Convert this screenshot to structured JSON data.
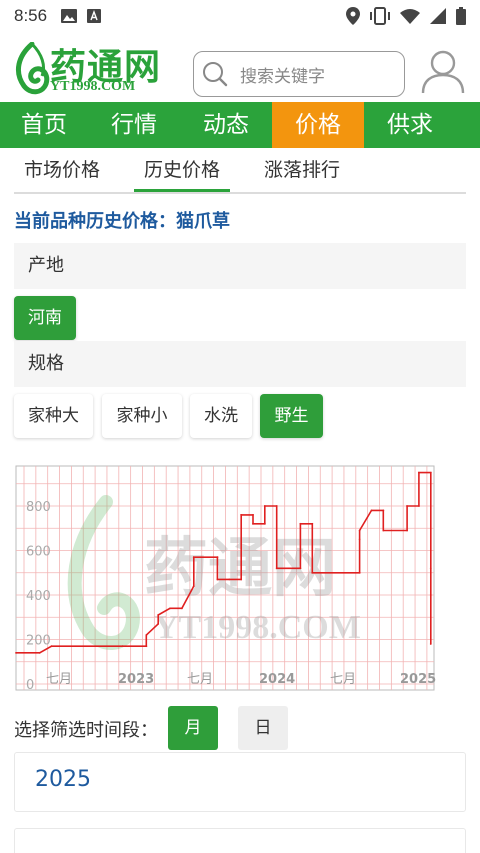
{
  "status_bar": {
    "time": "8:56"
  },
  "header": {
    "logo_text": "药通网",
    "logo_sub": "YT1998.COM",
    "search_placeholder": "搜索关键字"
  },
  "nav": {
    "items": [
      "首页",
      "行情",
      "动态",
      "价格",
      "供求"
    ],
    "active": "价格"
  },
  "subtabs": {
    "items": [
      "市场价格",
      "历史价格",
      "涨落排行"
    ],
    "active": "历史价格"
  },
  "title": "当前品种历史价格：猫爪草",
  "origin": {
    "label": "产地",
    "options": [
      "河南"
    ],
    "selected": "河南"
  },
  "spec": {
    "label": "规格",
    "options": [
      "家种大",
      "家种小",
      "水洗",
      "野生"
    ],
    "selected": "野生"
  },
  "colors": {
    "brand_green": "#2ba33b",
    "active_orange": "#f3950e",
    "title_blue": "#1e5a9e",
    "line_red": "#e02020"
  },
  "chart_data": {
    "type": "line",
    "title": "",
    "xlabel": "",
    "ylabel": "",
    "ylim": [
      0,
      1000
    ],
    "y_ticks": [
      0,
      200,
      400,
      600,
      800
    ],
    "x_tick_labels": [
      "七月",
      "2023",
      "七月",
      "2024",
      "七月",
      "2025"
    ],
    "grid": true,
    "watermark": "药通网 YT1998.COM",
    "series": [
      {
        "name": "",
        "points": [
          [
            "2022-03",
            140
          ],
          [
            "2022-05",
            140
          ],
          [
            "2022-06",
            170
          ],
          [
            "2022-12",
            170
          ],
          [
            "2023-02",
            170
          ],
          [
            "2023-02",
            220
          ],
          [
            "2023-03",
            270
          ],
          [
            "2023-03",
            310
          ],
          [
            "2023-04",
            340
          ],
          [
            "2023-05",
            340
          ],
          [
            "2023-06",
            440
          ],
          [
            "2023-06",
            570
          ],
          [
            "2023-08",
            570
          ],
          [
            "2023-08",
            470
          ],
          [
            "2023-09",
            470
          ],
          [
            "2023-10",
            470
          ],
          [
            "2023-10",
            760
          ],
          [
            "2023-11",
            760
          ],
          [
            "2023-11",
            720
          ],
          [
            "2023-12",
            720
          ],
          [
            "2023-12",
            800
          ],
          [
            "2024-01",
            800
          ],
          [
            "2024-01",
            520
          ],
          [
            "2024-03",
            520
          ],
          [
            "2024-03",
            720
          ],
          [
            "2024-04",
            720
          ],
          [
            "2024-04",
            500
          ],
          [
            "2024-08",
            500
          ],
          [
            "2024-08",
            650
          ],
          [
            "2024-08",
            690
          ],
          [
            "2024-09",
            780
          ],
          [
            "2024-10",
            780
          ],
          [
            "2024-10",
            690
          ],
          [
            "2024-12",
            690
          ],
          [
            "2024-12",
            800
          ],
          [
            "2025-01",
            800
          ],
          [
            "2025-01",
            950
          ],
          [
            "2025-02",
            950
          ],
          [
            "2025-02",
            520
          ],
          [
            "2025-02",
            400
          ],
          [
            "2025-02",
            180
          ]
        ]
      }
    ]
  },
  "period": {
    "label": "选择筛选时间段：",
    "options": [
      "月",
      "日"
    ],
    "selected": "月"
  },
  "year_list": [
    "2025"
  ]
}
